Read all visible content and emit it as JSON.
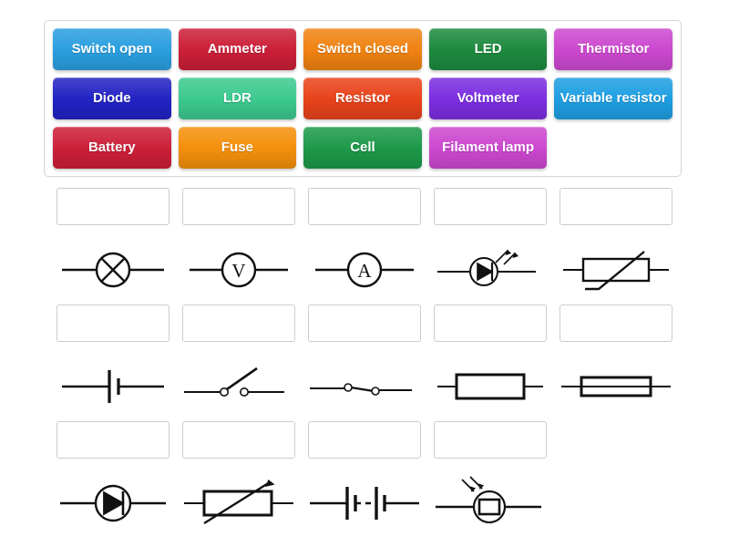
{
  "activity": {
    "type": "match-up",
    "title": "Circuit Symbols Match Up"
  },
  "tile_bank": {
    "name": "draggable-answer-tiles",
    "rows": [
      [
        {
          "label": "Switch open",
          "color": "#2b9fe0"
        },
        {
          "label": "Ammeter",
          "color": "#cc1f38"
        },
        {
          "label": "Switch closed",
          "color": "#f08312"
        },
        {
          "label": "LED",
          "color": "#1d8a3f"
        },
        {
          "label": "Thermistor",
          "color": "#cc48cf"
        }
      ],
      [
        {
          "label": "Diode",
          "color": "#2323c4"
        },
        {
          "label": "LDR",
          "color": "#3cc98f"
        },
        {
          "label": "Resistor",
          "color": "#e8431a"
        },
        {
          "label": "Voltmeter",
          "color": "#7b2ee0"
        },
        {
          "label": "Variable resistor",
          "color": "#1e9fe2"
        }
      ],
      [
        {
          "label": "Battery",
          "color": "#cc1f38"
        },
        {
          "label": "Fuse",
          "color": "#f4900c"
        },
        {
          "label": "Cell",
          "color": "#1d9949"
        },
        {
          "label": "Filament lamp",
          "color": "#cc48cf"
        },
        {
          "label": "",
          "color": ""
        }
      ]
    ]
  },
  "answer_grid": {
    "name": "circuit-symbol-answer-grid",
    "dropzone_placeholder": "",
    "rows": [
      [
        {
          "symbol": "filament-lamp",
          "dropzone_value": ""
        },
        {
          "symbol": "voltmeter",
          "dropzone_value": ""
        },
        {
          "symbol": "ammeter",
          "dropzone_value": ""
        },
        {
          "symbol": "led",
          "dropzone_value": ""
        },
        {
          "symbol": "thermistor",
          "dropzone_value": ""
        }
      ],
      [
        {
          "symbol": "cell",
          "dropzone_value": ""
        },
        {
          "symbol": "switch-open",
          "dropzone_value": ""
        },
        {
          "symbol": "switch-closed",
          "dropzone_value": ""
        },
        {
          "symbol": "resistor",
          "dropzone_value": ""
        },
        {
          "symbol": "fuse",
          "dropzone_value": ""
        }
      ],
      [
        {
          "symbol": "diode",
          "dropzone_value": ""
        },
        {
          "symbol": "variable-resistor",
          "dropzone_value": ""
        },
        {
          "symbol": "battery",
          "dropzone_value": ""
        },
        {
          "symbol": "ldr",
          "dropzone_value": ""
        }
      ]
    ]
  },
  "style": {
    "symbol_stroke": "#111111",
    "dropzone_border": "#cccccc",
    "bank_border": "#d4d4d4",
    "page_background": "#ffffff"
  }
}
